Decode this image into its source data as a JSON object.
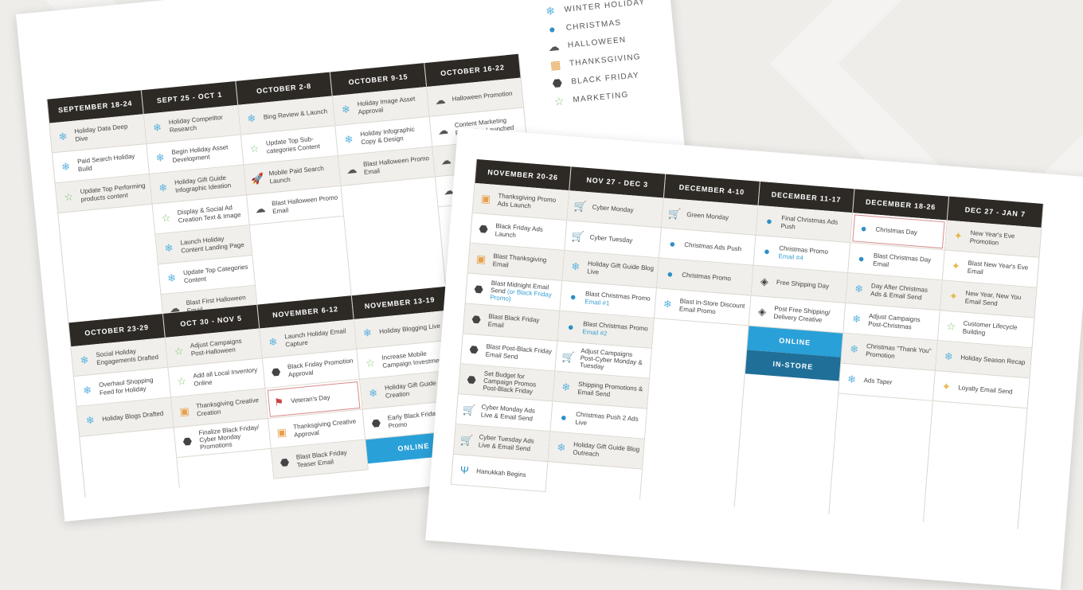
{
  "icons": {
    "snowflake-icon": "❄",
    "ornament-icon": "●",
    "ghost-icon": "☁",
    "star-icon": "☆",
    "cart-icon": "🛒",
    "rocket-icon": "🚀",
    "tag-icon": "⬣",
    "gift-icon": "▣",
    "calendar-icon": "▦",
    "flag-icon": "⚑",
    "monitor-icon": "▭",
    "present-icon": "◈",
    "party-icon": "✦",
    "menorah-icon": "Ψ"
  },
  "colors": {
    "snowflake": "#5cb3df",
    "ornament": "#2f90c6",
    "ghost": "#555555",
    "star": "#7bc36a",
    "cart": "#9b59b6",
    "rocket": "#9b59b6",
    "gift": "#e6a04a",
    "tag": "#444444",
    "present": "#444444",
    "flag": "#c84444",
    "party": "#e6b84a",
    "menorah": "#2f90c6",
    "calendar": "#e6a04a"
  },
  "legend": [
    {
      "label": "WINTER HOLIDAY",
      "icon": "snowflake-icon",
      "color": "#5cb3df"
    },
    {
      "label": "CHRISTMAS",
      "icon": "ornament-icon",
      "color": "#2f90c6"
    },
    {
      "label": "HALLOWEEN",
      "icon": "ghost-icon",
      "color": "#555555"
    },
    {
      "label": "THANKSGIVING",
      "icon": "calendar-icon",
      "color": "#e6a04a"
    },
    {
      "label": "BLACK FRIDAY",
      "icon": "tag-icon",
      "color": "#444444"
    },
    {
      "label": "MARKETING",
      "icon": "star-icon",
      "color": "#7bc36a"
    }
  ],
  "sheet1_top": [
    {
      "header": "SEPTEMBER 18-24",
      "items": [
        {
          "t": "Holiday Data Deep Dive",
          "i": "snowflake"
        },
        {
          "t": "Paid Search Holiday Build",
          "i": "snowflake"
        },
        {
          "t": "Update Top Performing products content",
          "i": "star"
        }
      ]
    },
    {
      "header": "SEPT 25 - OCT 1",
      "items": [
        {
          "t": "Holiday Competitor Research",
          "i": "snowflake"
        },
        {
          "t": "Begin Holiday Asset Development",
          "i": "snowflake"
        },
        {
          "t": "Holiday Gift Guide Infographic Ideation",
          "i": "snowflake"
        },
        {
          "t": "Display & Social Ad Creation Text & Image",
          "i": "star"
        },
        {
          "t": "Launch Holiday Content Landing Page",
          "i": "snowflake"
        },
        {
          "t": "Update Top Categories Content",
          "i": "snowflake"
        },
        {
          "t": "Blast First Halloween Email",
          "i": "ghost"
        }
      ]
    },
    {
      "header": "OCTOBER 2-8",
      "items": [
        {
          "t": "Bing Review & Launch",
          "i": "snowflake"
        },
        {
          "t": "Update Top Sub-categories Content",
          "i": "star"
        },
        {
          "t": "Mobile Paid Search Launch",
          "i": "rocket"
        },
        {
          "t": "Blast Halloween Promo Email",
          "i": "ghost"
        }
      ]
    },
    {
      "header": "OCTOBER 9-15",
      "items": [
        {
          "t": "Holiday Image Asset Approval",
          "i": "snowflake"
        },
        {
          "t": "Holiday Infographic Copy & Design",
          "i": "snowflake"
        },
        {
          "t": "Blast Halloween Promo Email",
          "i": "ghost"
        }
      ]
    },
    {
      "header": "OCTOBER 16-22",
      "items": [
        {
          "t": "Halloween Promotion",
          "i": "ghost"
        },
        {
          "t": "Content Marketing Promotion Launched",
          "i": "ghost"
        },
        {
          "t": "Hallowe",
          "i": "ghost"
        },
        {
          "t": "Blast Hallo",
          "i": "ghost"
        }
      ]
    }
  ],
  "sheet1_bottom": [
    {
      "header": "OCTOBER 23-29",
      "items": [
        {
          "t": "Social Holiday Engagements Drafted",
          "i": "snowflake"
        },
        {
          "t": "Overhaul Shopping Feed for Holiday",
          "i": "snowflake"
        },
        {
          "t": "Holiday Blogs Drafted",
          "i": "snowflake"
        }
      ]
    },
    {
      "header": "OCT 30 - NOV 5",
      "items": [
        {
          "t": "Adjust Campaigns Post-Halloween",
          "i": "star"
        },
        {
          "t": "Add all Local Inventory Online",
          "i": "star"
        },
        {
          "t": "Thanksgiving Creative Creation",
          "i": "gift"
        },
        {
          "t": "Finalize Black Friday/ Cyber Monday Promotions",
          "i": "tag"
        }
      ]
    },
    {
      "header": "NOVEMBER 6-12",
      "items": [
        {
          "t": "Launch Holiday Email Capture",
          "i": "snowflake"
        },
        {
          "t": "Black Friday Promotion Approval",
          "i": "tag"
        },
        {
          "t": "Veteran's Day",
          "i": "flag",
          "hl": true
        },
        {
          "t": "Thanksgiving Creative Approval",
          "i": "gift"
        },
        {
          "t": "Blast Black Friday Teaser Email",
          "i": "tag"
        }
      ]
    },
    {
      "header": "NOVEMBER 13-19",
      "items": [
        {
          "t": "Holiday Blogging Live",
          "i": "snowflake"
        },
        {
          "t": "Increase Mobile Campaign Investments",
          "i": "star"
        },
        {
          "t": "Holiday Gift Guide Blog Creation",
          "i": "snowflake"
        },
        {
          "t": "Early Black Friday Promo",
          "i": "tag"
        }
      ],
      "band": "ONLINE"
    }
  ],
  "sheet2": [
    {
      "header": "NOVEMBER 20-26",
      "items": [
        {
          "t": "Thanksgiving Promo Ads Launch",
          "i": "gift"
        },
        {
          "t": "Black Friday Ads Launch",
          "i": "tag"
        },
        {
          "t": "Blast Thanksgiving Email",
          "i": "gift"
        },
        {
          "t": "Blast Midnight Email Send",
          "s": "(or Black Friday Promo)",
          "i": "tag"
        },
        {
          "t": "Blast Black Friday Email",
          "i": "tag"
        },
        {
          "t": "Blast Post-Black Friday Email Send",
          "i": "tag"
        },
        {
          "t": "Set Budget for Campaign Promos Post-Black Friday",
          "i": "tag"
        },
        {
          "t": "Cyber Monday Ads Live & Email Send",
          "i": "cart"
        },
        {
          "t": "Cyber Tuesday Ads Live & Email Send",
          "i": "cart"
        },
        {
          "t": "Hanukkah Begins",
          "i": "menorah"
        }
      ]
    },
    {
      "header": "NOV 27 - DEC 3",
      "items": [
        {
          "t": "Cyber Monday",
          "i": "cart"
        },
        {
          "t": "Cyber Tuesday",
          "i": "cart"
        },
        {
          "t": "Holiday Gift Guide Blog Live",
          "i": "snowflake"
        },
        {
          "t": "Blast Christmas Promo",
          "s": "Email #1",
          "i": "ornament"
        },
        {
          "t": "Blast Christmas Promo",
          "s": "Email #2",
          "i": "ornament"
        },
        {
          "t": "Adjust Campaigns Post-Cyber Monday & Tuesday",
          "i": "cart"
        },
        {
          "t": "Shipping Promotions & Email Send",
          "i": "snowflake"
        },
        {
          "t": "Christmas Push 2 Ads Live",
          "i": "ornament"
        },
        {
          "t": "Holiday Gift Guide Blog Outreach",
          "i": "snowflake"
        }
      ]
    },
    {
      "header": "DECEMBER 4-10",
      "items": [
        {
          "t": "Green Monday",
          "i": "cart"
        },
        {
          "t": "Christmas Ads Push",
          "i": "ornament"
        },
        {
          "t": "Christmas Promo",
          "i": "ornament"
        },
        {
          "t": "Blast In-Store Discount Email Promo",
          "i": "snowflake"
        }
      ]
    },
    {
      "header": "DECEMBER 11-17",
      "items": [
        {
          "t": "Final Christmas Ads Push",
          "i": "ornament"
        },
        {
          "t": "Christmas Promo",
          "s": "Email #4",
          "i": "ornament"
        },
        {
          "t": "Free Shipping Day",
          "i": "present"
        },
        {
          "t": "Post Free Shipping/ Delivery Creative",
          "i": "present"
        }
      ],
      "band": "ONLINE",
      "band2": "IN-STORE"
    },
    {
      "header": "DECEMBER 18-26",
      "items": [
        {
          "t": "Christmas Day",
          "i": "ornament",
          "hl": true
        },
        {
          "t": "Blast Christmas Day Email",
          "i": "ornament"
        },
        {
          "t": "Day After Christmas Ads & Email Send",
          "i": "snowflake"
        },
        {
          "t": "Adjust Campaigns Post-Christmas",
          "i": "snowflake"
        },
        {
          "t": "Christmas \"Thank You\" Promotion",
          "i": "snowflake"
        },
        {
          "t": "Ads Taper",
          "i": "snowflake"
        }
      ]
    },
    {
      "header": "DEC 27 - JAN 7",
      "items": [
        {
          "t": "New Year's Eve Promotion",
          "i": "party"
        },
        {
          "t": "Blast New Year's Eve Email",
          "i": "party"
        },
        {
          "t": "New Year, New You Email Send",
          "i": "party"
        },
        {
          "t": "Customer Lifecycle Building",
          "i": "star"
        },
        {
          "t": "Holiday Season Recap",
          "i": "snowflake"
        },
        {
          "t": "Loyalty Email Send",
          "i": "party"
        }
      ]
    }
  ]
}
